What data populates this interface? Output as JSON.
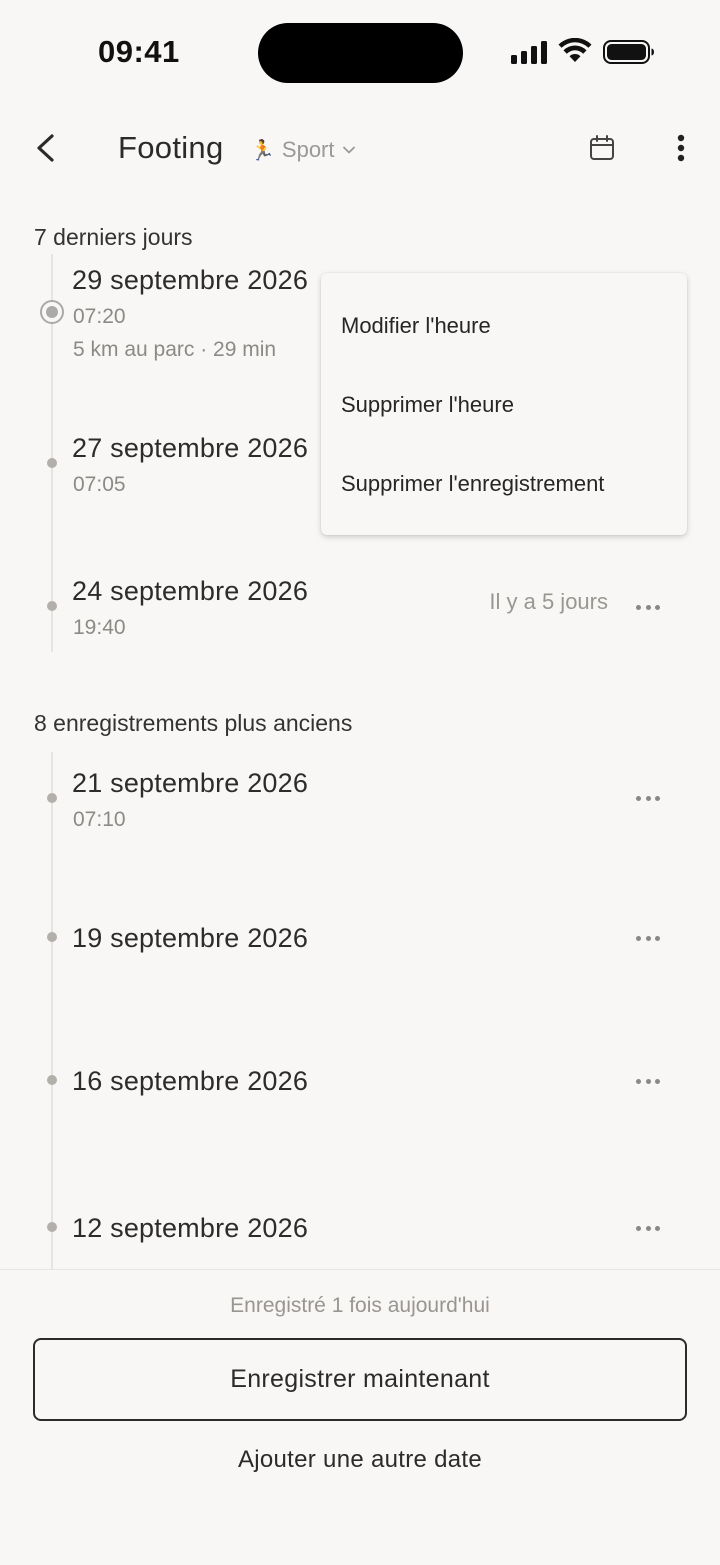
{
  "status_bar": {
    "time": "09:41"
  },
  "header": {
    "title": "Footing",
    "category_emoji": "🏃",
    "category": "Sport",
    "icons": [
      "back-arrow-icon",
      "chevron-down-icon",
      "calendar-icon",
      "more-vertical-icon"
    ]
  },
  "sections": [
    {
      "label": "7 derniers jours"
    },
    {
      "label": "8 enregistrements plus anciens"
    }
  ],
  "recent_entries": [
    {
      "date": "29 septembre 2026",
      "time": "07:20",
      "note": "5 km au parc · 29 min",
      "selected": true
    },
    {
      "date": "27 septembre 2026",
      "time": "07:05"
    },
    {
      "date": "24 septembre 2026",
      "time": "19:40",
      "relative": "Il y a 5 jours"
    }
  ],
  "older_entries": [
    {
      "date": "21 septembre 2026",
      "time": "07:10"
    },
    {
      "date": "19 septembre 2026"
    },
    {
      "date": "16 septembre 2026"
    },
    {
      "date": "12 septembre 2026"
    }
  ],
  "context_menu": {
    "items": [
      "Modifier l'heure",
      "Supprimer l'heure",
      "Supprimer l'enregistrement"
    ]
  },
  "footer": {
    "status": "Enregistré 1 fois aujourd'hui",
    "primary_button": "Enregistrer maintenant",
    "secondary_link": "Ajouter une autre date"
  },
  "colors": {
    "background": "#f8f7f5",
    "text": "#2b2b2b",
    "muted": "#8d8a86",
    "category_accent": "#c89a2a"
  }
}
